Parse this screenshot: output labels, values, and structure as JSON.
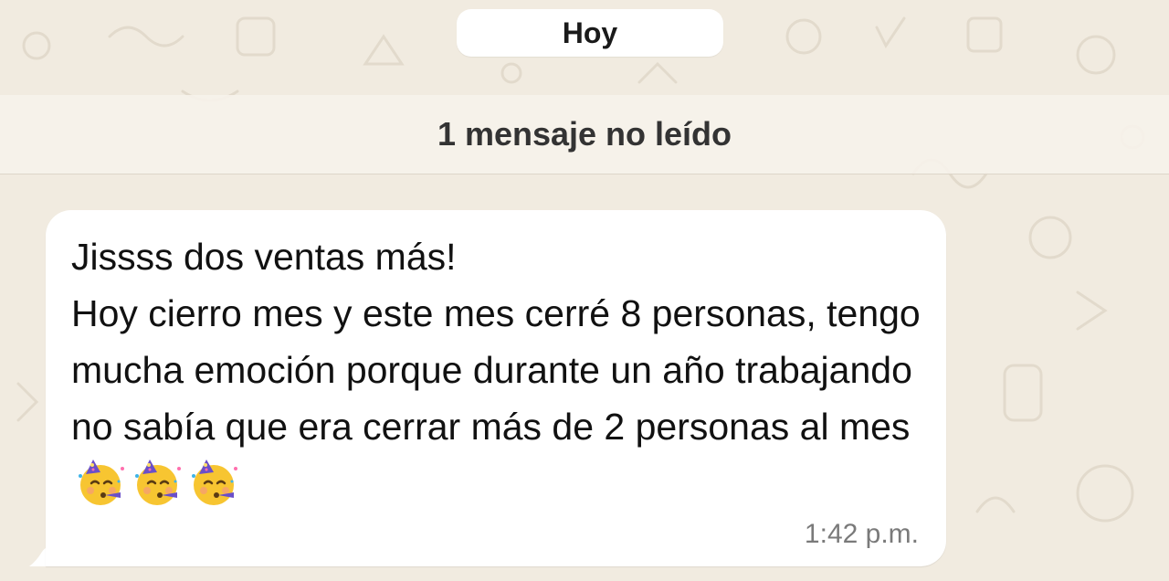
{
  "chat": {
    "date_divider": "Hoy",
    "unread_banner": "1 mensaje no leído"
  },
  "message": {
    "text": "Jissss dos ventas más!\nHoy cierro mes y este mes cerré 8 personas, tengo mucha emoción porque durante un año trabajando no sabía que era cerrar más de 2 personas al mes",
    "emojis": [
      "partying-face",
      "partying-face",
      "partying-face"
    ],
    "time": "1:42 p.m."
  },
  "colors": {
    "wallpaper": "#f1ebe0",
    "bubble": "#ffffff",
    "timestamp": "#7a7a7a"
  }
}
